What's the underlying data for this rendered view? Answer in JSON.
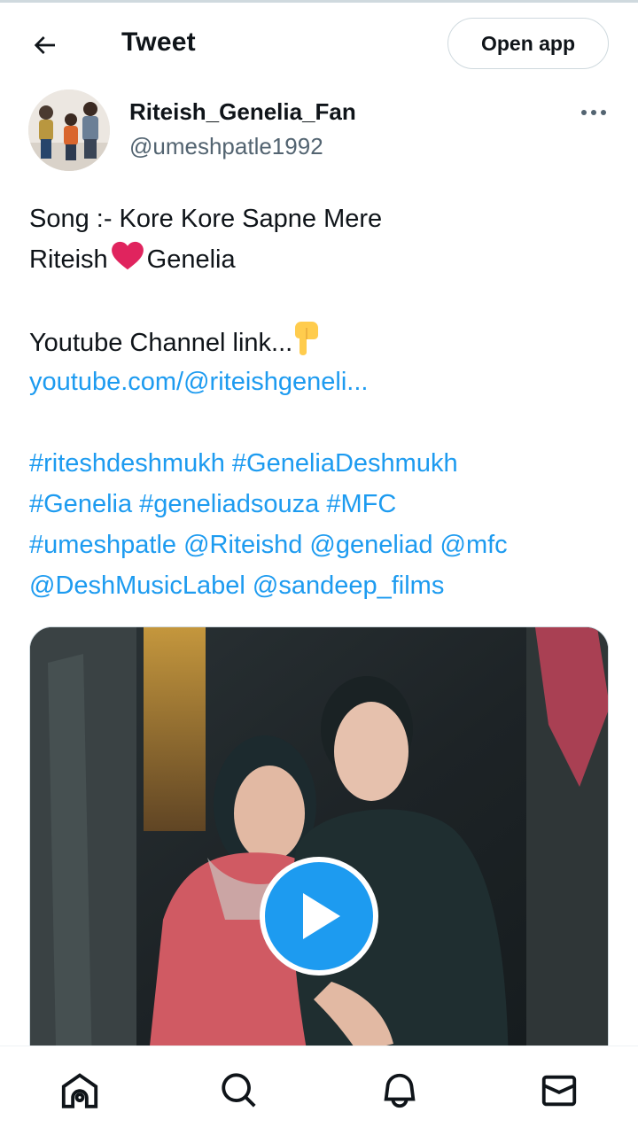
{
  "header": {
    "title": "Tweet",
    "open_app_label": "Open app"
  },
  "author": {
    "display_name": "Riteish_Genelia_Fan",
    "handle": "@umeshpatle1992"
  },
  "tweet": {
    "line1": "Song :- Kore Kore Sapne Mere",
    "line2_before": "Riteish",
    "line2_after": "Genelia",
    "line3": "Youtube Channel link...",
    "link": "youtube.com/@riteishgeneli...",
    "tags_line1": "#riteshdeshmukh #GeneliaDeshmukh",
    "tags_line2": "#Genelia #geneliadsouza #MFC",
    "tags_line3": "#umeshpatle @Riteishd @geneliad @mfc",
    "tags_line4": "@DeshMusicLabel @sandeep_films"
  },
  "icons": {
    "back": "arrow-left-icon",
    "more": "more-horizontal-icon",
    "heart": "red-heart-emoji",
    "pointing": "backhand-index-pointing-down-emoji",
    "play": "play-icon",
    "home": "home-icon",
    "search": "search-icon",
    "notifications": "bell-icon",
    "messages": "mail-icon"
  },
  "colors": {
    "link": "#1d9bf0",
    "text": "#0f1419",
    "secondary": "#536471",
    "heart": "#e0245e"
  }
}
